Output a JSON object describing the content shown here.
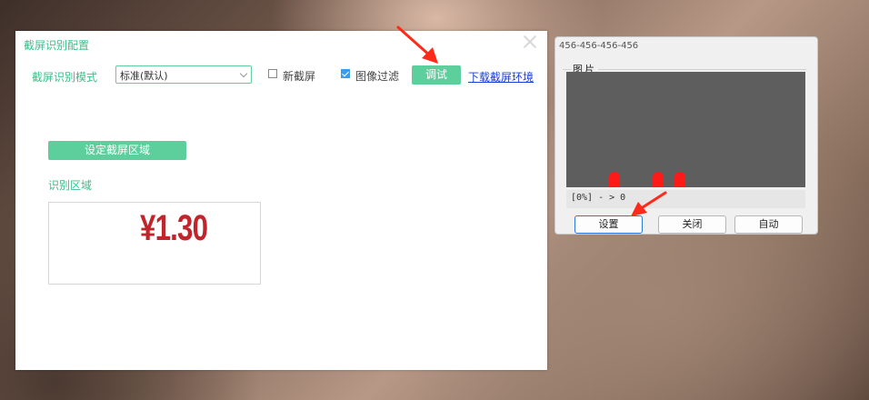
{
  "config_dialog": {
    "title": "截屏识别配置",
    "mode_label": "截屏识别模式",
    "mode_value": "标准(默认)",
    "new_capture_label": "新截屏",
    "new_capture_checked": false,
    "image_filter_label": "图像过滤",
    "image_filter_checked": true,
    "debug_button": "调试",
    "download_link": "下载截屏环境",
    "set_region_button": "设定截屏区域",
    "region_label": "识别区域",
    "recognized_value": "¥1.30"
  },
  "capture_window": {
    "title": "456-456-456-456",
    "group_label": "图片",
    "status": "[0%] - > 0",
    "buttons": [
      "设置",
      "关闭",
      "自动"
    ]
  },
  "colors": {
    "accent_green": "#3cbf8a",
    "button_green": "#5ccf9c",
    "price_red": "#c0252c",
    "marker_red": "#ff1a1a",
    "link_blue": "#1a3fd6"
  }
}
